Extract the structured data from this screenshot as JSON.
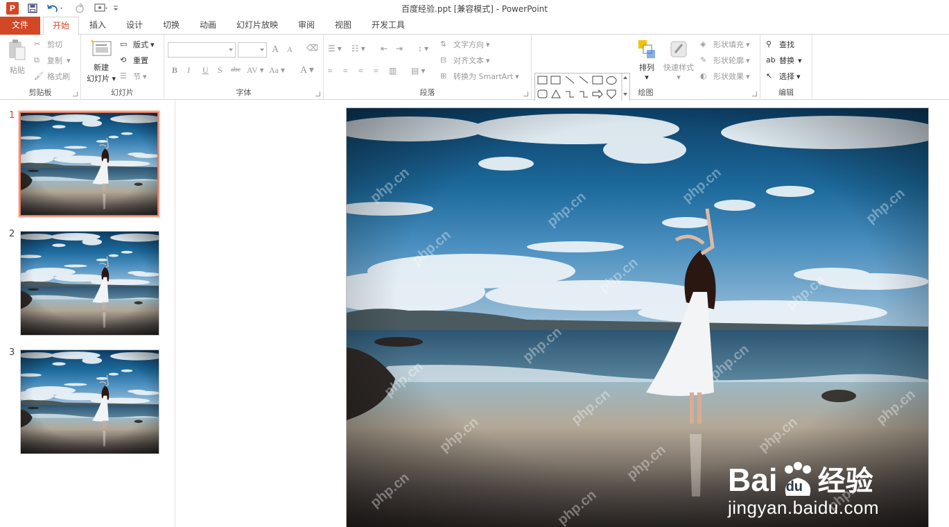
{
  "window": {
    "title": "百度经验.ppt [兼容模式] - PowerPoint",
    "app_icon": "P"
  },
  "quick_access": [
    "save-icon",
    "undo-icon",
    "redo-icon",
    "touch-mode-icon",
    "customize-icon"
  ],
  "tabs": [
    "文件",
    "开始",
    "插入",
    "设计",
    "切换",
    "动画",
    "幻灯片放映",
    "审阅",
    "视图",
    "开发工具"
  ],
  "active_tab": "开始",
  "ribbon": {
    "clipboard": {
      "label": "剪贴板",
      "paste": "粘贴",
      "cut": "剪切",
      "copy": "复制",
      "format_painter": "格式刷"
    },
    "slides": {
      "label": "幻灯片",
      "new_slide_1": "新建",
      "new_slide_2": "幻灯片",
      "layout": "版式",
      "reset": "重置",
      "section": "节"
    },
    "font": {
      "label": "字体",
      "bold": "B",
      "italic": "I",
      "underline": "U",
      "shadow": "S",
      "strike": "abc",
      "spacing": "AV",
      "case": "Aa",
      "color": "A",
      "grow": "A",
      "shrink": "A"
    },
    "paragraph": {
      "label": "段落",
      "text_direction": "文字方向",
      "align_text": "对齐文本",
      "smartart": "转换为 SmartArt"
    },
    "drawing": {
      "label": "绘图",
      "arrange": "排列",
      "quick_styles": "快速样式",
      "shape_fill": "形状填充",
      "shape_outline": "形状轮廓",
      "shape_effects": "形状效果"
    },
    "editing": {
      "label": "编辑",
      "find": "查找",
      "replace": "替换",
      "select": "选择"
    }
  },
  "slides": [
    {
      "number": "1"
    },
    {
      "number": "2"
    },
    {
      "number": "3"
    }
  ],
  "watermark": {
    "text": "php.cn",
    "brand_1": "Bai",
    "brand_paw": "du",
    "brand_2": "经验",
    "brand_url": "jingyan.baidu.com"
  },
  "colors": {
    "accent": "#d24726",
    "ribbon_bg": "#ffffff",
    "selected_thumb": "#e07a5f"
  }
}
